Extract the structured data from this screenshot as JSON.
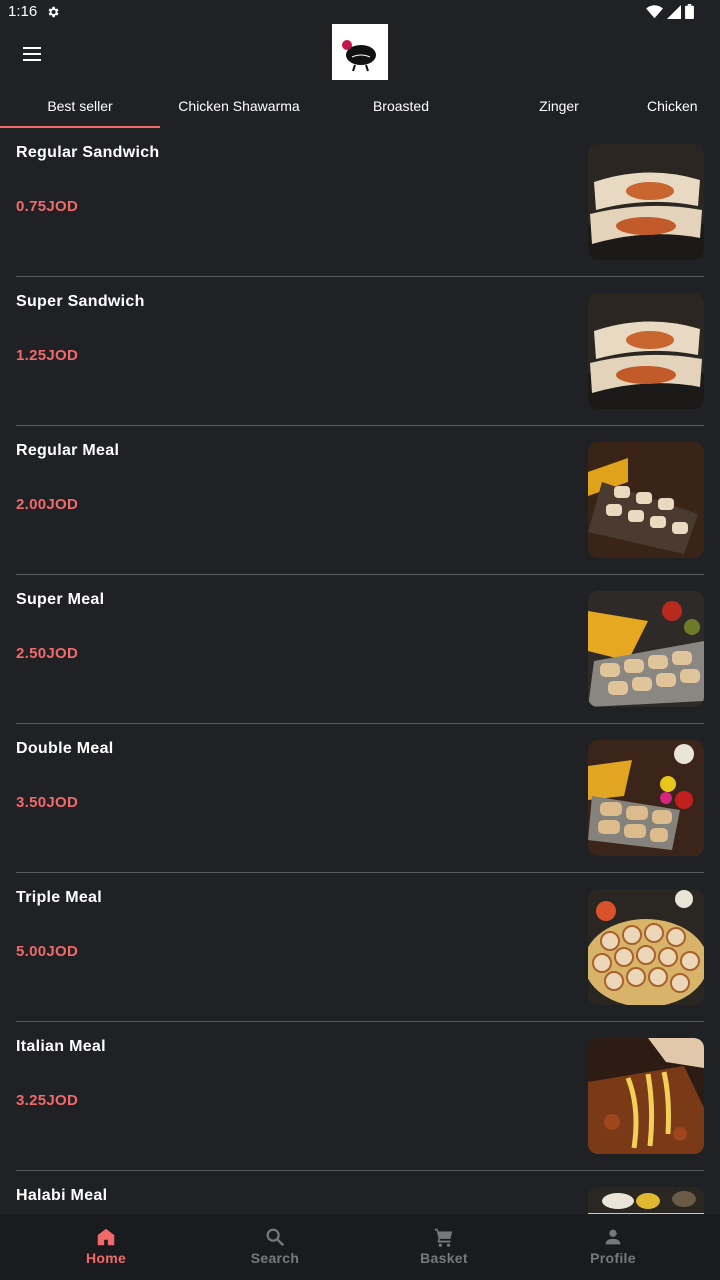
{
  "status_bar": {
    "time": "1:16"
  },
  "tabs": [
    {
      "label": "Best seller",
      "active": true
    },
    {
      "label": "Chicken Shawarma"
    },
    {
      "label": "Broasted"
    },
    {
      "label": "Zinger"
    },
    {
      "label": "Chicken"
    }
  ],
  "menu": [
    {
      "name": "Regular Sandwich",
      "price": "0.75JOD"
    },
    {
      "name": "Super Sandwich",
      "price": "1.25JOD"
    },
    {
      "name": "Regular Meal",
      "price": "2.00JOD"
    },
    {
      "name": "Super Meal",
      "price": "2.50JOD"
    },
    {
      "name": "Double Meal",
      "price": "3.50JOD"
    },
    {
      "name": "Triple Meal",
      "price": "5.00JOD"
    },
    {
      "name": "Italian Meal",
      "price": "3.25JOD"
    },
    {
      "name": "Halabi Meal",
      "price": ""
    }
  ],
  "bottom_nav": [
    {
      "label": "Home",
      "icon": "home-icon",
      "active": true
    },
    {
      "label": "Search",
      "icon": "search-icon"
    },
    {
      "label": "Basket",
      "icon": "cart-icon"
    },
    {
      "label": "Profile",
      "icon": "person-icon"
    }
  ],
  "colors": {
    "background": "#202125",
    "accent": "#f06a6a",
    "nav_inactive": "#77787c",
    "divider": "#5a5b60"
  }
}
